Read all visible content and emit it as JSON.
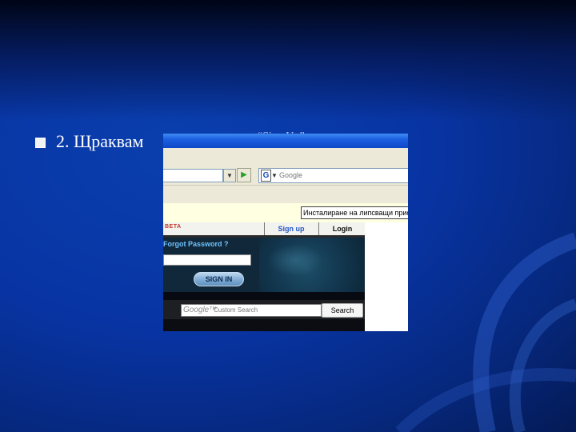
{
  "slide": {
    "bullet_text": "2. Щраквам",
    "bullet_tail": "“Sign Up”"
  },
  "browser": {
    "google_toolbar": {
      "logo": "G",
      "placeholder": "Google"
    },
    "infobar": {
      "label": "Инсталиране на липсващи приставки"
    }
  },
  "website": {
    "beta_badge": "BETA",
    "nav": {
      "signup": "Sign up",
      "login": "Login"
    },
    "login_form": {
      "forgot_password": "Forgot Password ?",
      "sign_in_button": "SIGN IN"
    },
    "search": {
      "logo": "Google™",
      "placeholder": "Custom Search",
      "button": "Search"
    }
  }
}
